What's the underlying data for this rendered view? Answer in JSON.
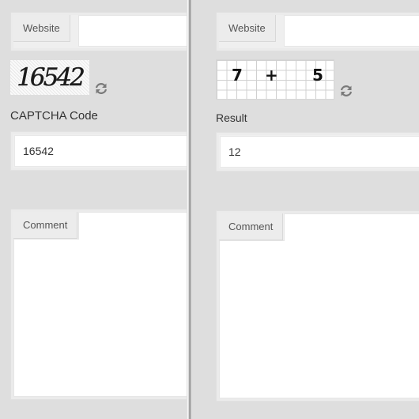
{
  "left_form": {
    "website_label": "Website",
    "captcha_text": "16542",
    "captcha_code_label": "CAPTCHA Code",
    "captcha_code_value": "16542",
    "comment_label": "Comment"
  },
  "right_form": {
    "website_label": "Website",
    "math_operand_a": "7",
    "math_operator": "+",
    "math_operand_b": "5",
    "result_label": "Result",
    "result_value": "12",
    "comment_label": "Comment"
  },
  "icons": {
    "refresh": "refresh-arrows-icon"
  },
  "colors": {
    "background": "#dedede",
    "panel": "#efefef",
    "label_tab": "#ececec",
    "text": "#333333"
  }
}
